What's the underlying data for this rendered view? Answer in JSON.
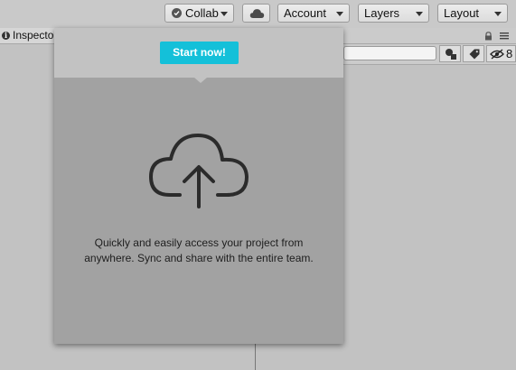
{
  "toolbar": {
    "collab_label": "Collab",
    "account_label": "Account",
    "layers_label": "Layers",
    "layout_label": "Layout",
    "icons": {
      "collab": "check-icon",
      "cloud": "cloud-icon",
      "dropdown": "chevron-down-icon"
    }
  },
  "inspector": {
    "tab_label": "Inspector",
    "search": {
      "value": "",
      "placeholder": ""
    },
    "hidden_count": "8"
  },
  "collab_popup": {
    "button_label": "Start now!",
    "message_line1": "Quickly and easily access your project from",
    "message_line2": "anywhere. Sync and share with the entire team.",
    "icon": "upload-cloud-icon"
  },
  "colors": {
    "accent": "#14c0d9",
    "toolbar_bg": "#c9c9c9",
    "popup_bg": "#a2a2a2",
    "popup_header_bg": "#c2c2c2"
  }
}
